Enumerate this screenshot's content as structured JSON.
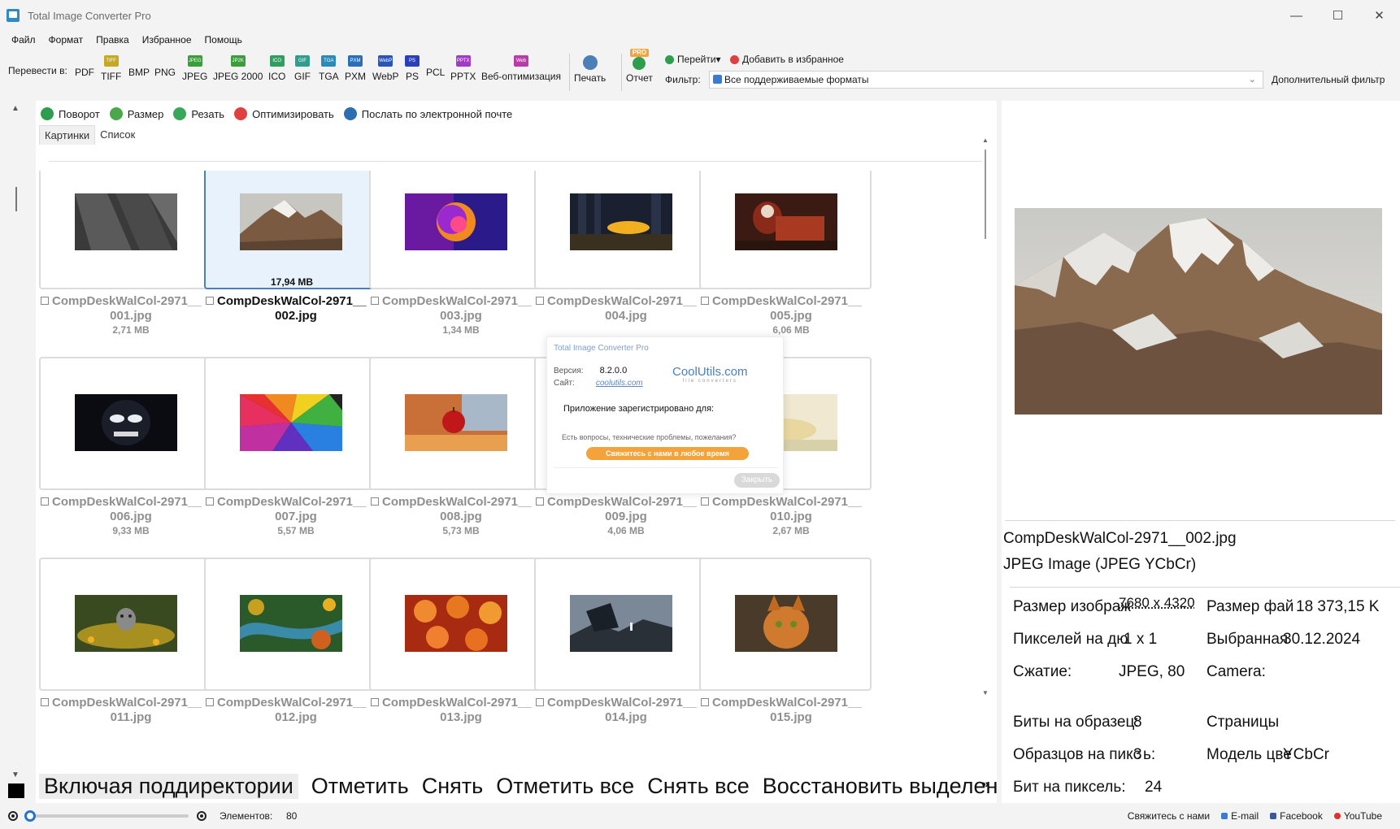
{
  "window": {
    "title": "Total Image Converter Pro",
    "controls": [
      "—",
      "☐",
      "✕"
    ]
  },
  "menu": [
    "Файл",
    "Формат",
    "Правка",
    "Избранное",
    "Помощь"
  ],
  "toolbar": {
    "convert_label": "Перевести в:",
    "formats": [
      {
        "label": "PDF",
        "icon": "none",
        "color": ""
      },
      {
        "label": "TIFF",
        "icon": "TIFF",
        "color": "#c7a820"
      },
      {
        "label": "BMP",
        "icon": "none",
        "color": ""
      },
      {
        "label": "PNG",
        "icon": "none",
        "color": ""
      },
      {
        "label": "JPEG",
        "icon": "JPEG",
        "color": "#3c9d3c"
      },
      {
        "label": "JPEG 2000",
        "icon": "JP2K",
        "color": "#3c9d3c"
      },
      {
        "label": "ICO",
        "icon": "ICO",
        "color": "#2f9e5e"
      },
      {
        "label": "GIF",
        "icon": "GIF",
        "color": "#2f9e8e"
      },
      {
        "label": "TGA",
        "icon": "TGA",
        "color": "#2a8ab8"
      },
      {
        "label": "PXM",
        "icon": "PXM",
        "color": "#2a6fb8"
      },
      {
        "label": "WebP",
        "icon": "WebP",
        "color": "#2a55b8"
      },
      {
        "label": "PS",
        "icon": "PS",
        "color": "#2a3fb8"
      },
      {
        "label": "PCL",
        "icon": "none",
        "color": ""
      },
      {
        "label": "PPTX",
        "icon": "PPTX",
        "color": "#a13bc7"
      },
      {
        "label": "Веб-оптимизация",
        "icon": "Web",
        "color": "#b83ba8"
      }
    ],
    "print_label": "Печать",
    "report_label": "Отчет",
    "report_badge": "PRO",
    "goto_label": "Перейти▾",
    "favorite_label": "Добавить в избранное",
    "filter_label": "Фильтр:",
    "filter_value": "Все поддерживаемые форматы",
    "extra_filter_label": "Дополнительный фильтр"
  },
  "actions": [
    {
      "label": "Поворот",
      "color": "#2e9e4e"
    },
    {
      "label": "Размер",
      "color": "#4aa84a"
    },
    {
      "label": "Резать",
      "color": "#3aa65a"
    },
    {
      "label": "Оптимизировать",
      "color": "#e04040"
    },
    {
      "label": "Послать по электронной почте",
      "color": "#2c6fb0"
    }
  ],
  "tabs": [
    "Картинки",
    "Список"
  ],
  "files": [
    {
      "name1": "CompDeskWalCol-2971__",
      "name2": "001.jpg",
      "size": "2,71 MB",
      "badge": "",
      "selected": false
    },
    {
      "name1": "CompDeskWalCol-2971__",
      "name2": "002.jpg",
      "size": "",
      "badge": "17,94 MB",
      "selected": true
    },
    {
      "name1": "CompDeskWalCol-2971__",
      "name2": "003.jpg",
      "size": "1,34 MB",
      "badge": "",
      "selected": false
    },
    {
      "name1": "CompDeskWalCol-2971__",
      "name2": "004.jpg",
      "size": "",
      "badge": "",
      "selected": false
    },
    {
      "name1": "CompDeskWalCol-2971__",
      "name2": "005.jpg",
      "size": "6,06 MB",
      "badge": "",
      "selected": false
    },
    {
      "name1": "CompDeskWalCol-2971__",
      "name2": "006.jpg",
      "size": "9,33 MB",
      "badge": "",
      "selected": false
    },
    {
      "name1": "CompDeskWalCol-2971__",
      "name2": "007.jpg",
      "size": "5,57 MB",
      "badge": "",
      "selected": false
    },
    {
      "name1": "CompDeskWalCol-2971__",
      "name2": "008.jpg",
      "size": "5,73 MB",
      "badge": "",
      "selected": false
    },
    {
      "name1": "CompDeskWalCol-2971__",
      "name2": "009.jpg",
      "size": "4,06 MB",
      "badge": "",
      "selected": false
    },
    {
      "name1": "CompDeskWalCol-2971__",
      "name2": "010.jpg",
      "size": "2,67 MB",
      "badge": "",
      "selected": false
    },
    {
      "name1": "CompDeskWalCol-2971__",
      "name2": "011.jpg",
      "size": "",
      "badge": "",
      "selected": false
    },
    {
      "name1": "CompDeskWalCol-2971__",
      "name2": "012.jpg",
      "size": "",
      "badge": "",
      "selected": false
    },
    {
      "name1": "CompDeskWalCol-2971__",
      "name2": "013.jpg",
      "size": "",
      "badge": "",
      "selected": false
    },
    {
      "name1": "CompDeskWalCol-2971__",
      "name2": "014.jpg",
      "size": "",
      "badge": "",
      "selected": false
    },
    {
      "name1": "CompDeskWalCol-2971__",
      "name2": "015.jpg",
      "size": "",
      "badge": "",
      "selected": false
    }
  ],
  "bottom_actions": [
    "Включая поддиректории",
    "Отметить",
    "Снять",
    "Отметить все",
    "Снять все",
    "Восстановить выделение"
  ],
  "bottom_more": "»",
  "about": {
    "title": "Total Image Converter Pro",
    "version_label": "Версия:",
    "version": "8.2.0.0",
    "site_label": "Сайт:",
    "site": "coolutils.com",
    "logo": "CoolUtils.com",
    "logo_tag": "file converters",
    "registered": "Приложение зарегистрировано для:",
    "question": "Есть вопросы, технические проблемы, пожелания?",
    "contact_btn": "Свяжитесь с нами в любое время",
    "close_btn": "Закрыть"
  },
  "preview": {
    "filename": "CompDeskWalCol-2971__002.jpg",
    "filetype": "JPEG Image (JPEG YCbCr)",
    "info": {
      "img_size_label": "Размер изображ",
      "img_size": "7680 x 4320",
      "file_size_label": "Размер фай",
      "file_size": "18 373,15 K",
      "ppi_label": "Пикселей на дю",
      "ppi": "1 x 1",
      "selected_label": "Выбранная ",
      "selected": "30.12.2024",
      "compression_label": "Сжатие:",
      "compression": "JPEG, 80",
      "camera_label": "Camera:",
      "bits_sample_label": "Биты на образец:",
      "bits_sample": "8",
      "pages_label": "Страницы",
      "samples_px_label": "Образцов на пикс",
      "samples_px": "3",
      "samples_px_suffix": "ь:",
      "color_model_label": "Модель цве",
      "color_model": "YCbCr",
      "bits_px_label": "Бит на пиксель:",
      "bits_px": "24"
    }
  },
  "status": {
    "count_label": "Элементов:",
    "count": "80",
    "links": [
      {
        "label": "Свяжитесь с нами",
        "color": ""
      },
      {
        "label": "E-mail",
        "color": "#3a7bd5"
      },
      {
        "label": "Facebook",
        "color": "#3b5998"
      },
      {
        "label": "YouTube",
        "color": "#e03030"
      }
    ]
  },
  "colors": {
    "accent": "#2474c8",
    "selection_border": "#4a7fb8",
    "selection_bg": "#e8f2fc",
    "muted_text": "#8f8f8f"
  }
}
